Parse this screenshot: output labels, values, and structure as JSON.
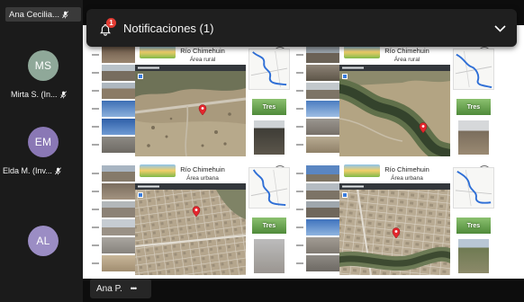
{
  "notification": {
    "title": "Notificaciones (1)",
    "badge": "1",
    "icon": "bell-icon",
    "expand_icon": "chevron-down-icon",
    "badge_color": "#e23b33"
  },
  "participants": [
    {
      "name": "Ana Cecilia...",
      "mic_icon": "mic-off-icon"
    },
    {
      "initials": "MS",
      "name": "Mirta S. (In...",
      "mic_icon": "mic-off-icon",
      "avatar_color": "#8fa899"
    },
    {
      "initials": "EM",
      "name": "Elda M. (Inv...",
      "mic_icon": "mic-off-icon",
      "avatar_color": "#8a78b5"
    },
    {
      "initials": "AL",
      "avatar_color": "#9b8dc4"
    }
  ],
  "presenter": {
    "name": "Ana P.",
    "more": "•••"
  },
  "slide": {
    "panels": [
      {
        "number": "1",
        "title": "Río Chimehuin",
        "subtitle": "Área rural",
        "land_cover": "Tres"
      },
      {
        "number": "2",
        "title": "Río Chimehuin",
        "subtitle": "Área rural",
        "land_cover": "Tres"
      },
      {
        "number": "3",
        "title": "Río Chimehuin",
        "subtitle": "Área urbana",
        "land_cover": "Tres"
      },
      {
        "number": "4",
        "title": "Río Chimehuin",
        "subtitle": "Área urbana",
        "land_cover": "Tres"
      }
    ]
  }
}
